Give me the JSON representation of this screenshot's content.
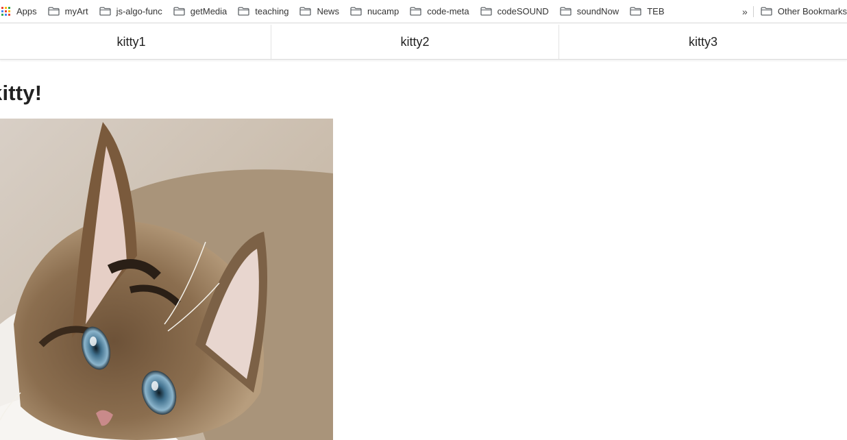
{
  "bookmarks": {
    "apps_label": "Apps",
    "items": [
      {
        "label": "myArt"
      },
      {
        "label": "js-algo-func"
      },
      {
        "label": "getMedia"
      },
      {
        "label": "teaching"
      },
      {
        "label": "News"
      },
      {
        "label": "nucamp"
      },
      {
        "label": "code-meta"
      },
      {
        "label": "codeSOUND"
      },
      {
        "label": "soundNow"
      },
      {
        "label": "TEB"
      }
    ],
    "overflow_symbol": "»",
    "other_label": "Other Bookmarks"
  },
  "tabs": [
    {
      "label": "kitty1"
    },
    {
      "label": "kitty2"
    },
    {
      "label": "kitty3"
    }
  ],
  "main": {
    "heading": "kitty!"
  },
  "icons": {
    "folder": "folder-icon",
    "apps": "apps-grid-icon",
    "overflow": "chevron-double-right-icon"
  },
  "colors": {
    "apps_grid": [
      "#ea4335",
      "#fbbc05",
      "#34a853",
      "#4285f4",
      "#ea4335",
      "#fbbc05",
      "#34a853",
      "#4285f4",
      "#ea4335"
    ]
  }
}
